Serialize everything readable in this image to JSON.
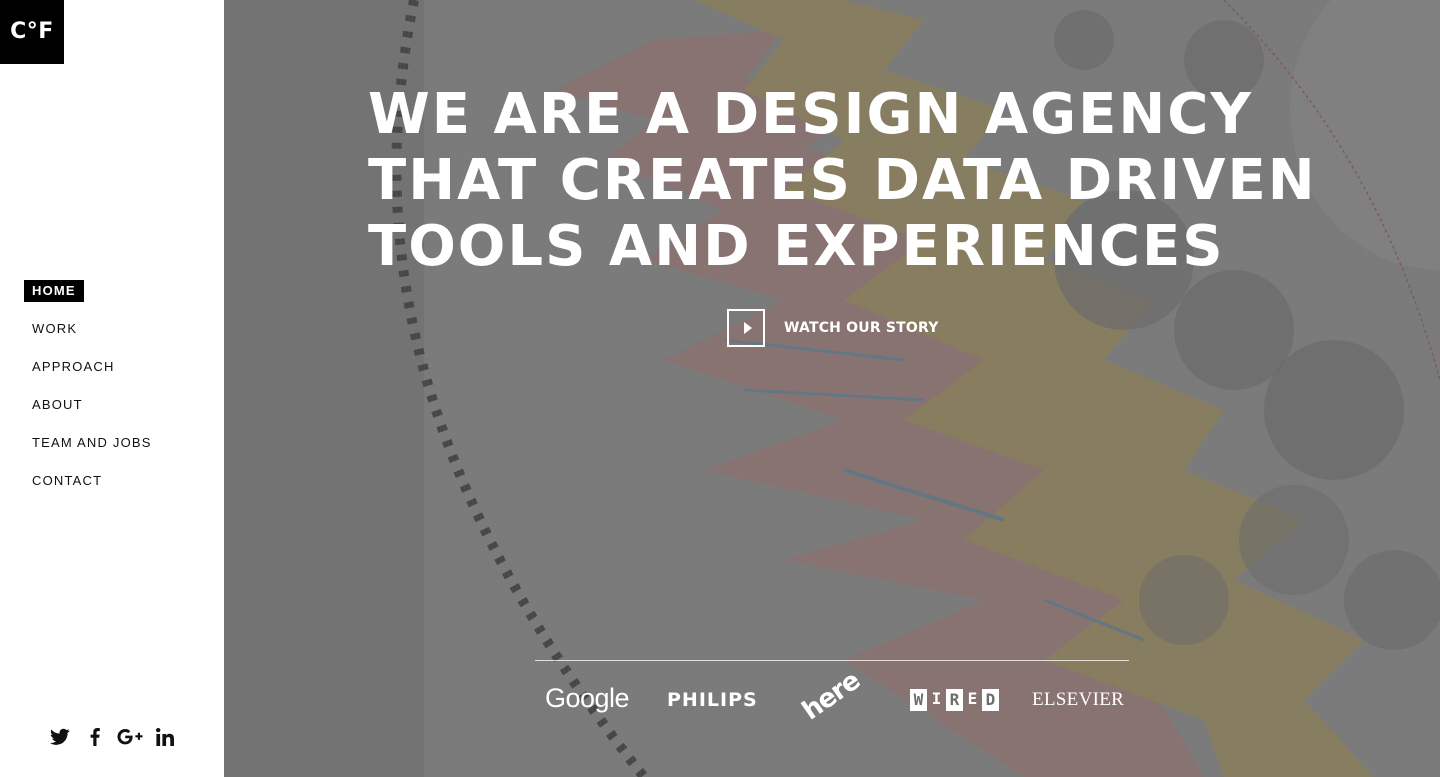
{
  "brand": {
    "logo_text": "C°F"
  },
  "nav": {
    "items": [
      {
        "label": "HOME",
        "active": true
      },
      {
        "label": "WORK",
        "active": false
      },
      {
        "label": "APPROACH",
        "active": false
      },
      {
        "label": "ABOUT",
        "active": false
      },
      {
        "label": "TEAM AND JOBS",
        "active": false
      },
      {
        "label": "CONTACT",
        "active": false
      }
    ]
  },
  "social": [
    "twitter-icon",
    "facebook-icon",
    "google-plus-icon",
    "linkedin-icon"
  ],
  "hero": {
    "title_lines": [
      "WE ARE A DESIGN AGENCY",
      "THAT CREATES DATA DRIVEN",
      "TOOLS AND EXPERIENCES"
    ],
    "watch_label": "WATCH OUR STORY"
  },
  "clients": {
    "google": "Google",
    "philips": "PHILIPS",
    "here": "here",
    "wired": [
      "W",
      "I",
      "R",
      "E",
      "D"
    ],
    "elsevier": "ELSEVIER"
  },
  "colors": {
    "sidebar_bg": "#ffffff",
    "text": "#111111",
    "active_bg": "#000000",
    "overlay": "#6e6e6e"
  }
}
